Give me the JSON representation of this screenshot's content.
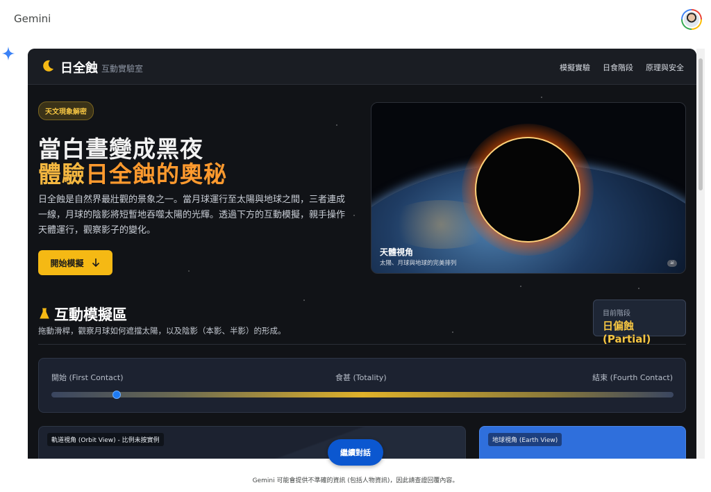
{
  "gemini": {
    "title": "Gemini",
    "continue_label": "繼續對話",
    "disclaimer": "Gemini 可能會提供不準確的資訊 (包括人物資訊)，因此請查證回覆內容。"
  },
  "app": {
    "brand": "日全蝕",
    "brand_sub": "互動實驗室",
    "nav": [
      "模擬實驗",
      "日食階段",
      "原理與安全"
    ],
    "badge": "天文現象解密",
    "headline_line1": "當白晝變成黑夜",
    "headline_line2_a": "體驗",
    "headline_line2_b": "日全蝕的奧秘",
    "intro": "日全蝕是自然界最壯觀的景象之一。當月球運行至太陽與地球之間，三者連成一線，月球的陰影將短暫地吞噬太陽的光輝。透過下方的互動模擬，親手操作天體運行，觀察影子的變化。",
    "start_label": "開始模擬",
    "hero": {
      "title": "天體視角",
      "subtitle": "太陽、月球與地球的完美排列",
      "ai_tag": "ai"
    },
    "section": {
      "title": "互動模擬區",
      "desc": "拖動滑桿，觀察月球如何遮擋太陽，以及陰影（本影、半影）的形成。"
    },
    "phase": {
      "label": "目前階段",
      "value": "日偏蝕 (Partial)"
    },
    "slider": {
      "start": "開始 (First Contact)",
      "mid": "食甚 (Totality)",
      "end": "結束 (Fourth Contact)",
      "progress": 0.105
    },
    "panels": {
      "orbit": "軌道視角 (Orbit View) - 比例未按實例",
      "earth": "地球視角 (Earth View)"
    }
  },
  "colors": {
    "accent": "#f5b914",
    "accent_orange": "#ff9a2e",
    "slider_thumb": "#1f7bf2",
    "continue_button": "#0b57d0"
  },
  "icons": [
    "gemini-spark-icon",
    "avatar",
    "moon-icon",
    "arrow-down-icon",
    "flask-icon"
  ]
}
